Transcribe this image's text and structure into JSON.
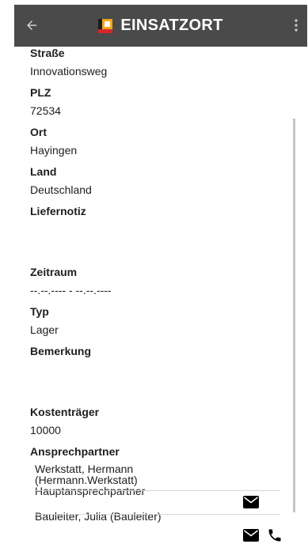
{
  "app_bar": {
    "title": "EINSATZORT",
    "background": "#4a4a4a",
    "icons": {
      "back": "arrow-left-icon",
      "logo": "app-logo-icon",
      "menu": "more-vertical-icon"
    }
  },
  "fields": {
    "strasse": {
      "label": "Straße",
      "value": "Innovationsweg"
    },
    "plz": {
      "label": "PLZ",
      "value": "72534"
    },
    "ort": {
      "label": "Ort",
      "value": "Hayingen"
    },
    "land": {
      "label": "Land",
      "value": "Deutschland"
    },
    "liefernotiz": {
      "label": "Liefernotiz",
      "value": ""
    },
    "zeitraum": {
      "label": "Zeitraum",
      "value": "--.--.---- - --.--.----"
    },
    "typ": {
      "label": "Typ",
      "value": "Lager"
    },
    "bemerkung": {
      "label": "Bemerkung",
      "value": ""
    },
    "kostentraeger": {
      "label": "Kostenträger",
      "value": "10000"
    }
  },
  "contacts": {
    "label": "Ansprechpartner",
    "items": [
      {
        "line1": "Werkstatt, Hermann",
        "line2": "(Hermann.Werkstatt)",
        "line3": "Hauptansprechpartner",
        "actions": [
          "mail-icon"
        ]
      },
      {
        "line1": "Bauleiter, Julia (Bauleiter)",
        "actions": [
          "mail-icon",
          "phone-icon"
        ]
      }
    ]
  }
}
